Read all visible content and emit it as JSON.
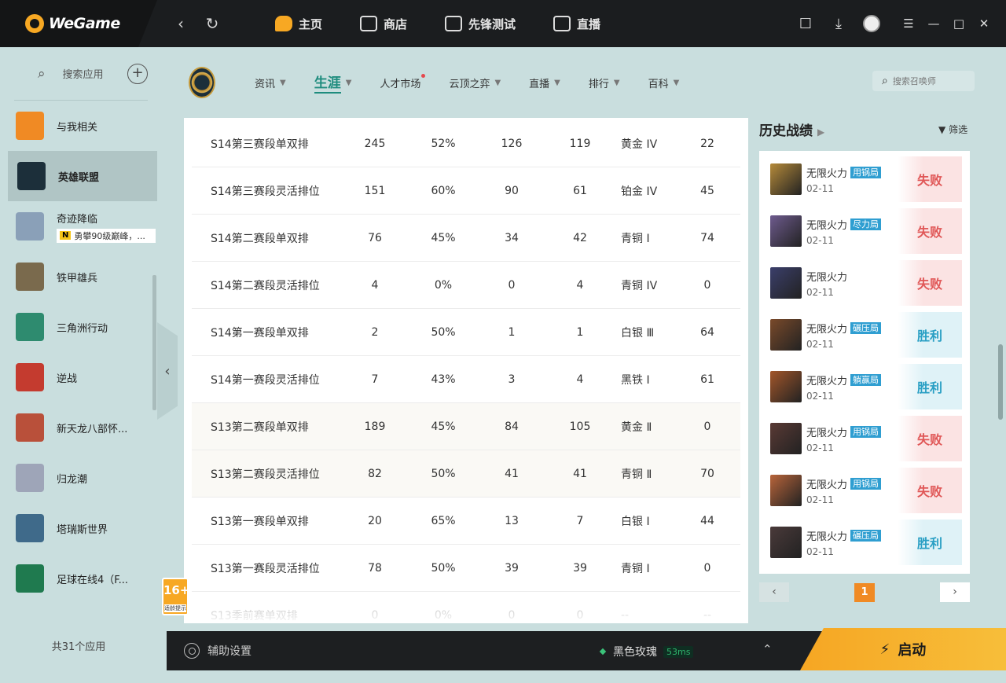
{
  "app": {
    "name": "WeGame"
  },
  "topnav": [
    {
      "label": "主页",
      "active": true
    },
    {
      "label": "商店"
    },
    {
      "label": "先锋测试"
    },
    {
      "label": "直播"
    }
  ],
  "sidebar": {
    "search_label": "搜索应用",
    "items": [
      {
        "label": "与我相关",
        "icon": "gamepad-icon",
        "color": "#f08a24"
      },
      {
        "label": "英雄联盟",
        "icon": "lol-icon",
        "color": "#1c2f3a",
        "active": true
      },
      {
        "label": "奇迹降临",
        "icon": "star-icon",
        "color": "#8aa0b8",
        "sub_badge": "N",
        "sub_text": "勇攀90级巅峰，..."
      },
      {
        "label": "铁甲雄兵",
        "icon": "bos-icon",
        "color": "#7a6a4d"
      },
      {
        "label": "三角洲行动",
        "icon": "delta-icon",
        "color": "#2e8b6f"
      },
      {
        "label": "逆战",
        "icon": "nizhan-icon",
        "color": "#c43b2f"
      },
      {
        "label": "新天龙八部怀...",
        "icon": "tianlong-icon",
        "color": "#b9503a"
      },
      {
        "label": "归龙潮",
        "icon": "guilong-icon",
        "color": "#9ea5b8"
      },
      {
        "label": "塔瑞斯世界",
        "icon": "tarisland-icon",
        "color": "#3f6a8a"
      },
      {
        "label": "足球在线4（F...",
        "icon": "fifa-icon",
        "color": "#1f7a4f"
      }
    ],
    "count_label": "共31个应用"
  },
  "lol_nav": [
    {
      "label": "资讯",
      "caret": true
    },
    {
      "label": "生涯",
      "caret": true,
      "active": true
    },
    {
      "label": "人才市场",
      "dot": true
    },
    {
      "label": "云顶之弈",
      "caret": true
    },
    {
      "label": "直播",
      "caret": true
    },
    {
      "label": "排行",
      "caret": true
    },
    {
      "label": "百科",
      "caret": true
    }
  ],
  "summoner_search": {
    "placeholder": "搜索召唤师"
  },
  "rank_table": [
    {
      "season": "S14第三赛段单双排",
      "games": "245",
      "winrate": "52%",
      "wins": "126",
      "losses": "119",
      "rank": "黄金 IV",
      "points": "22"
    },
    {
      "season": "S14第三赛段灵活排位",
      "games": "151",
      "winrate": "60%",
      "wins": "90",
      "losses": "61",
      "rank": "铂金 IV",
      "points": "45"
    },
    {
      "season": "S14第二赛段单双排",
      "games": "76",
      "winrate": "45%",
      "wins": "34",
      "losses": "42",
      "rank": "青铜 Ⅰ",
      "points": "74"
    },
    {
      "season": "S14第二赛段灵活排位",
      "games": "4",
      "winrate": "0%",
      "wins": "0",
      "losses": "4",
      "rank": "青铜 IV",
      "points": "0"
    },
    {
      "season": "S14第一赛段单双排",
      "games": "2",
      "winrate": "50%",
      "wins": "1",
      "losses": "1",
      "rank": "白银 Ⅲ",
      "points": "64"
    },
    {
      "season": "S14第一赛段灵活排位",
      "games": "7",
      "winrate": "43%",
      "wins": "3",
      "losses": "4",
      "rank": "黑铁 Ⅰ",
      "points": "61"
    },
    {
      "season": "S13第二赛段单双排",
      "games": "189",
      "winrate": "45%",
      "wins": "84",
      "losses": "105",
      "rank": "黄金 Ⅱ",
      "points": "0"
    },
    {
      "season": "S13第二赛段灵活排位",
      "games": "82",
      "winrate": "50%",
      "wins": "41",
      "losses": "41",
      "rank": "青铜 Ⅱ",
      "points": "70"
    },
    {
      "season": "S13第一赛段单双排",
      "games": "20",
      "winrate": "65%",
      "wins": "13",
      "losses": "7",
      "rank": "白银 Ⅰ",
      "points": "44"
    },
    {
      "season": "S13第一赛段灵活排位",
      "games": "78",
      "winrate": "50%",
      "wins": "39",
      "losses": "39",
      "rank": "青铜 Ⅰ",
      "points": "0"
    },
    {
      "season": "S13季前赛单双排",
      "games": "0",
      "winrate": "0%",
      "wins": "0",
      "losses": "0",
      "rank": "--",
      "points": "--"
    }
  ],
  "age_badge": {
    "age": "16+",
    "text": "适龄提示"
  },
  "history": {
    "title": "历史战绩",
    "filter_label": "筛选",
    "matches": [
      {
        "mode": "无限火力",
        "tag": "用锅局",
        "date": "02-11",
        "result": "失败",
        "win": false,
        "champ_color": "#b58a3a"
      },
      {
        "mode": "无限火力",
        "tag": "尽力局",
        "date": "02-11",
        "result": "失败",
        "win": false,
        "champ_color": "#6e5b8e"
      },
      {
        "mode": "无限火力",
        "tag": "",
        "date": "02-11",
        "result": "失败",
        "win": false,
        "champ_color": "#3b3f6b"
      },
      {
        "mode": "无限火力",
        "tag": "碾压局",
        "date": "02-11",
        "result": "胜利",
        "win": true,
        "champ_color": "#7a4a2a"
      },
      {
        "mode": "无限火力",
        "tag": "躺赢局",
        "date": "02-11",
        "result": "胜利",
        "win": true,
        "champ_color": "#a2562a"
      },
      {
        "mode": "无限火力",
        "tag": "用锅局",
        "date": "02-11",
        "result": "失败",
        "win": false,
        "champ_color": "#5a3a35"
      },
      {
        "mode": "无限火力",
        "tag": "用锅局",
        "date": "02-11",
        "result": "失败",
        "win": false,
        "champ_color": "#b8643a"
      },
      {
        "mode": "无限火力",
        "tag": "碾压局",
        "date": "02-11",
        "result": "胜利",
        "win": true,
        "champ_color": "#4a3a3a"
      }
    ],
    "current_page": "1"
  },
  "bottombar": {
    "assist_label": "辅助设置",
    "server_name": "黑色玫瑰",
    "ping": "53ms",
    "launch_label": "启动"
  },
  "colors": {
    "accent": "#f7a823",
    "lose": "#e05757",
    "win": "#2a9fc4",
    "active_tab": "#1e8c7e"
  }
}
